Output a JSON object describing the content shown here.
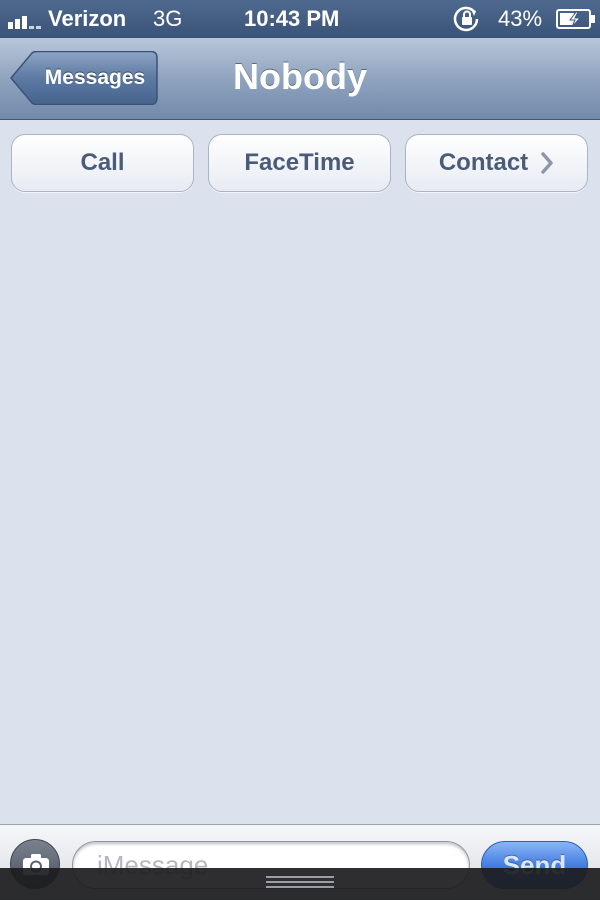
{
  "status_bar": {
    "carrier": "Verizon",
    "network": "3G",
    "time": "10:43 PM",
    "battery_percent": "43%",
    "icons": [
      "signal-icon",
      "rotation-lock-icon",
      "battery-charging-icon"
    ]
  },
  "nav_bar": {
    "back_label": "Messages",
    "title": "Nobody"
  },
  "actions": {
    "call_label": "Call",
    "facetime_label": "FaceTime",
    "contact_label": "Contact"
  },
  "compose": {
    "placeholder": "iMessage",
    "send_label": "Send",
    "icons": [
      "camera-icon"
    ]
  },
  "colors": {
    "status_bar": "#3f5a80",
    "nav_bar": "#8ea2be",
    "background": "#dbe2ed",
    "button_text": "#4b5c78",
    "send_button": "#3f7ae0"
  }
}
